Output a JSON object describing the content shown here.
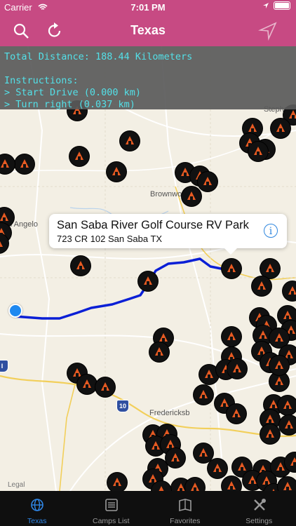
{
  "status_bar": {
    "carrier": "Carrier",
    "time": "7:01 PM"
  },
  "nav": {
    "title": "Texas",
    "search_icon": "search-icon",
    "refresh_icon": "refresh-icon",
    "location_icon": "location-arrow-icon"
  },
  "info_panel": {
    "total": "Total Distance: 188.44 Kilometers",
    "instructions_label": "Instructions:",
    "steps": [
      "> Start Drive (0.000 km)",
      "> Turn right (0.037 km)"
    ]
  },
  "map": {
    "labels": {
      "brownwood": "Brownwo",
      "san_angelo": "an Angelo",
      "fredericksburg": "Fredericksb",
      "stephenville": "Stephenvi"
    },
    "shields": [
      "10",
      "I"
    ],
    "legal": "Legal",
    "route_color": "#0a1fd6",
    "marker_color": "#e65a22"
  },
  "callout": {
    "title": "San Saba River Golf Course RV Park",
    "address": "723 CR 102  San Saba TX"
  },
  "tabs": [
    {
      "label": "Texas",
      "icon": "globe-icon",
      "active": true
    },
    {
      "label": "Camps List",
      "icon": "list-icon",
      "active": false
    },
    {
      "label": "Favorites",
      "icon": "book-icon",
      "active": false
    },
    {
      "label": "Settings",
      "icon": "tools-icon",
      "active": false
    }
  ]
}
